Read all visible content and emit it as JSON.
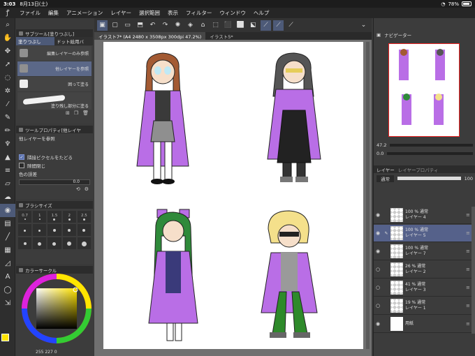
{
  "status": {
    "time": "3:03",
    "date": "8月13日(土)",
    "battery": "78%"
  },
  "menu": [
    "ファイル",
    "編集",
    "アニメーション",
    "レイヤー",
    "選択範囲",
    "表示",
    "フィルター",
    "ウィンドウ",
    "ヘルプ"
  ],
  "subtool": {
    "title": "サブツール[塗りつぶし]",
    "tabs": [
      "塗りつぶし",
      "ドット絵用バ"
    ],
    "items": [
      "編集レイヤーのみ参照",
      "他レイヤーを参照",
      "囲って塗る",
      "塗り残し部分に塗る"
    ]
  },
  "tool_property": {
    "title": "ツールプロパティ[他レイヤ",
    "mode": "他レイヤーを参照",
    "close_gap": "隣接ピクセルをたどる",
    "fill_gap": "隙間閉じ",
    "tolerance_label": "色の誤差",
    "tolerance_value": "0.0"
  },
  "brush_size": {
    "title": "ブラシサイズ",
    "sizes": [
      "0.7",
      "1",
      "1.5",
      "2",
      "2.5",
      "",
      "",
      "",
      "",
      "",
      "",
      "",
      "",
      "",
      "",
      "",
      "",
      "",
      "",
      ""
    ]
  },
  "color_circle": {
    "title": "カラーサークル",
    "readout": "255 227 0"
  },
  "document": {
    "tabs": [
      "イラスト7* (A4 2480 x 3508px 300dpi 47.2%)",
      "イラスト5*"
    ]
  },
  "navigator": {
    "title": "ナビゲーター",
    "zoom": "47.2",
    "angle": "0.0"
  },
  "layer_panel": {
    "tabs": [
      "レイヤー",
      "レイヤープロパティ"
    ],
    "blend_mode": "通常",
    "opacity": "100",
    "layers": [
      {
        "pct": "100 % 通常",
        "name": "レイヤー 4",
        "active": false
      },
      {
        "pct": "100 % 通常",
        "name": "レイヤー 5",
        "active": true
      },
      {
        "pct": "100 % 通常",
        "name": "レイヤー 7",
        "active": false
      },
      {
        "pct": "26 % 通常",
        "name": "レイヤー 2",
        "active": false
      },
      {
        "pct": "41 % 通常",
        "name": "レイヤー 3",
        "active": false
      },
      {
        "pct": "19 % 通常",
        "name": "レイヤー 1",
        "active": false
      },
      {
        "pct": "",
        "name": "用紙",
        "active": false
      }
    ]
  },
  "colors": {
    "accent": "#4d5a78",
    "fg": "#ffe300",
    "purple_coat": "#b96ee6"
  }
}
